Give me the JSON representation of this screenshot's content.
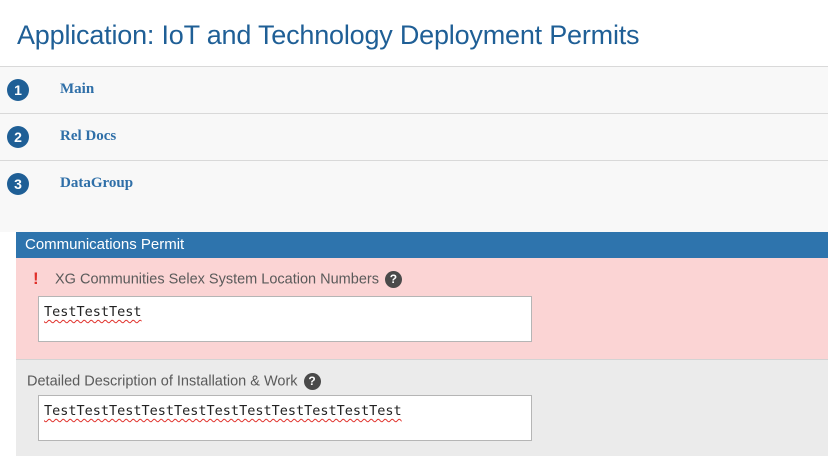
{
  "page": {
    "title": "Application: IoT and Technology Deployment Permits"
  },
  "steps": [
    {
      "number": "1",
      "label": "Main"
    },
    {
      "number": "2",
      "label": "Rel Docs"
    },
    {
      "number": "3",
      "label": "DataGroup"
    }
  ],
  "section": {
    "header": "Communications Permit",
    "fields": [
      {
        "required_mark": "!",
        "label": "XG Communities Selex System Location Numbers",
        "help_icon": "question-circle-icon",
        "value": "TestTestTest",
        "state": "error"
      },
      {
        "label": "Detailed Description of Installation & Work",
        "help_icon": "question-circle-icon",
        "value": "TestTestTestTestTestTestTestTestTestTestTest",
        "state": "normal"
      }
    ]
  },
  "colors": {
    "title": "#1f5f96",
    "step_circle": "#1f5f96",
    "step_label": "#2f6fa8",
    "panel_header": "#2e74ad",
    "error_background": "#fbd4d4",
    "required_mark": "#e0302a",
    "field_background": "#ebebeb"
  }
}
